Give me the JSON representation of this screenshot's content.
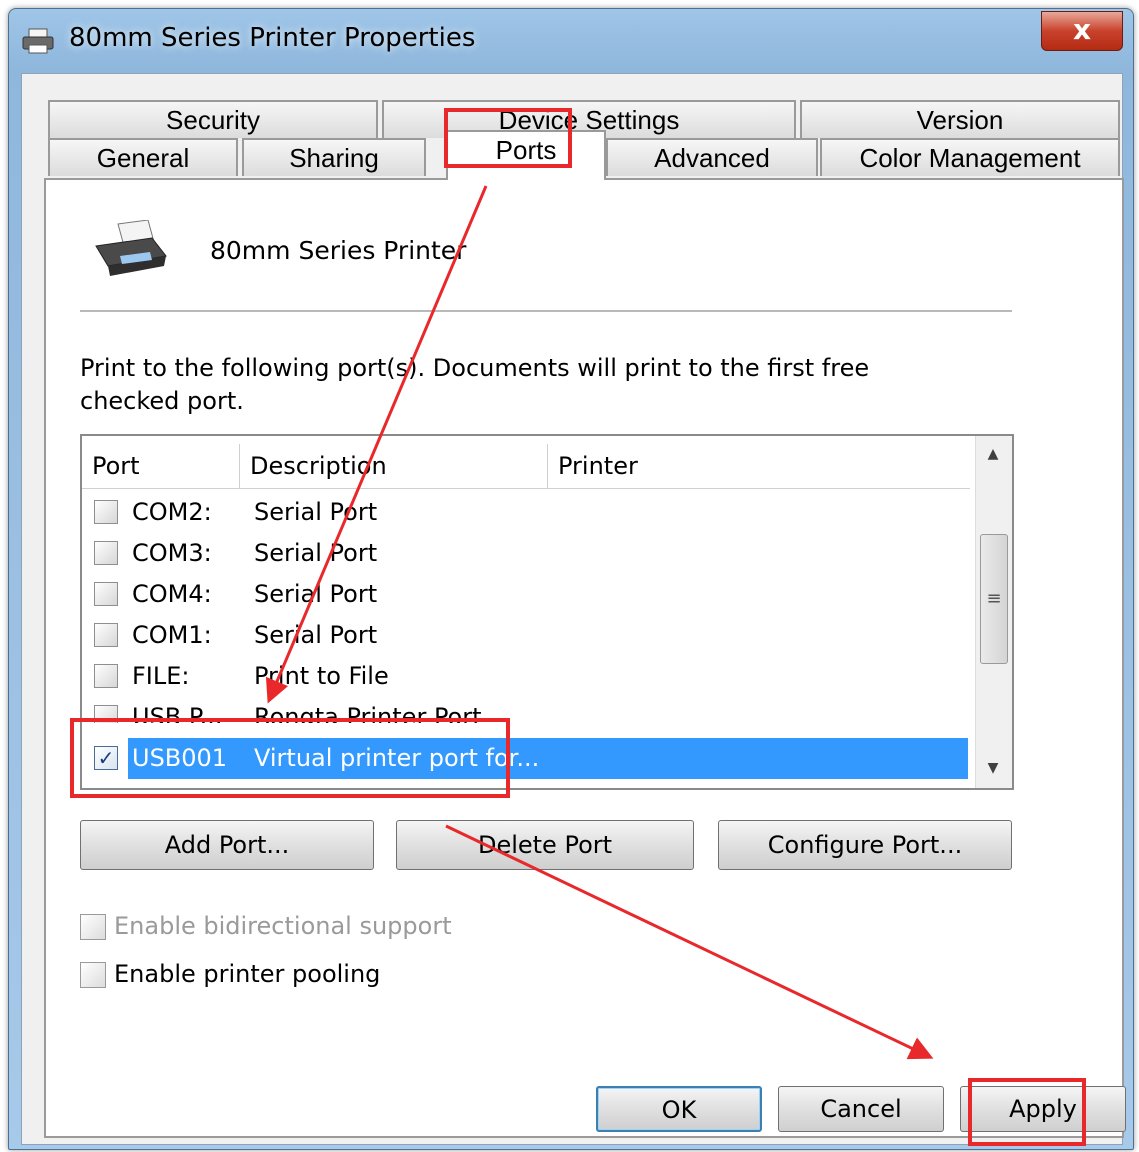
{
  "window": {
    "title": "80mm Series Printer Properties",
    "close_glyph": "x"
  },
  "tabs": {
    "row_back": [
      "Security",
      "Device Settings",
      "Version"
    ],
    "row_front": [
      "General",
      "Sharing",
      "Ports",
      "Advanced",
      "Color Management"
    ],
    "active": "Ports"
  },
  "printer": {
    "name": "80mm Series Printer",
    "icon": "printer-icon"
  },
  "ports_page": {
    "instructions": "Print to the following port(s). Documents will print to the first free checked port.",
    "columns": [
      "Port",
      "Description",
      "Printer"
    ],
    "rows": [
      {
        "port": "COM2:",
        "description": "Serial Port",
        "printer": "",
        "checked": false
      },
      {
        "port": "COM3:",
        "description": "Serial Port",
        "printer": "",
        "checked": false
      },
      {
        "port": "COM4:",
        "description": "Serial Port",
        "printer": "",
        "checked": false
      },
      {
        "port": "COM1:",
        "description": "Serial Port",
        "printer": "",
        "checked": false
      },
      {
        "port": "FILE:",
        "description": "Print to File",
        "printer": "",
        "checked": false
      },
      {
        "port": "USB P...",
        "description": "Rongta Printer Port",
        "printer": "",
        "checked": false
      }
    ],
    "selected_row": {
      "port": "USB001",
      "description": "Virtual printer port for...",
      "checked": true
    },
    "buttons": {
      "add": "Add Port...",
      "delete": "Delete Port",
      "configure": "Configure Port..."
    },
    "options": {
      "bidirectional": "Enable bidirectional support",
      "pooling": "Enable printer pooling"
    }
  },
  "footer": {
    "ok": "OK",
    "cancel": "Cancel",
    "apply": "Apply"
  },
  "colors": {
    "annotation": "#e8282a",
    "selection": "#3399ff"
  }
}
